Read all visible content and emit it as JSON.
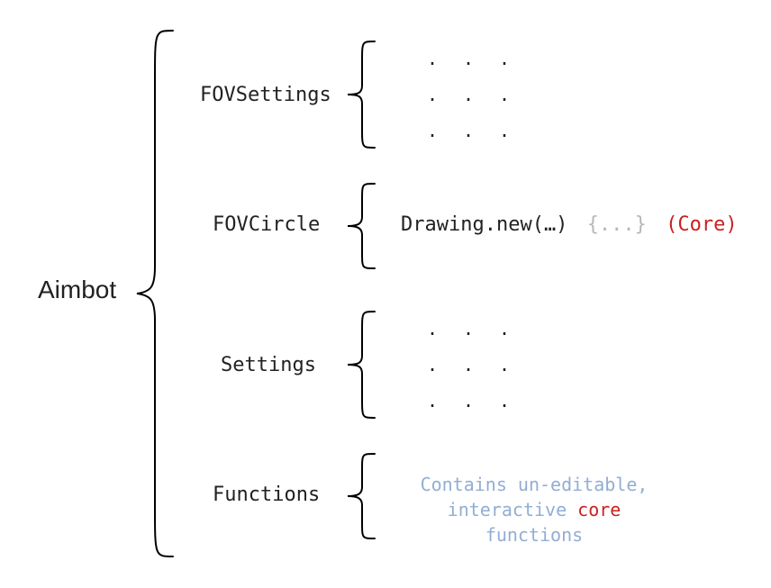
{
  "root": "Aimbot",
  "children": [
    {
      "label": "FOVSettings"
    },
    {
      "label": "FOVCircle"
    },
    {
      "label": "Settings"
    },
    {
      "label": "Functions"
    }
  ],
  "fovcircle": {
    "call": "Drawing.new(…)",
    "placeholder": "{...}",
    "core_tag": "(Core)"
  },
  "functions_desc": {
    "prefix": "Contains un-editable,",
    "line2a": "interactive ",
    "core_word": "core",
    "line2b": " functions"
  },
  "dots": [
    ".",
    ".",
    ".",
    ".",
    ".",
    ".",
    ".",
    ".",
    "."
  ]
}
